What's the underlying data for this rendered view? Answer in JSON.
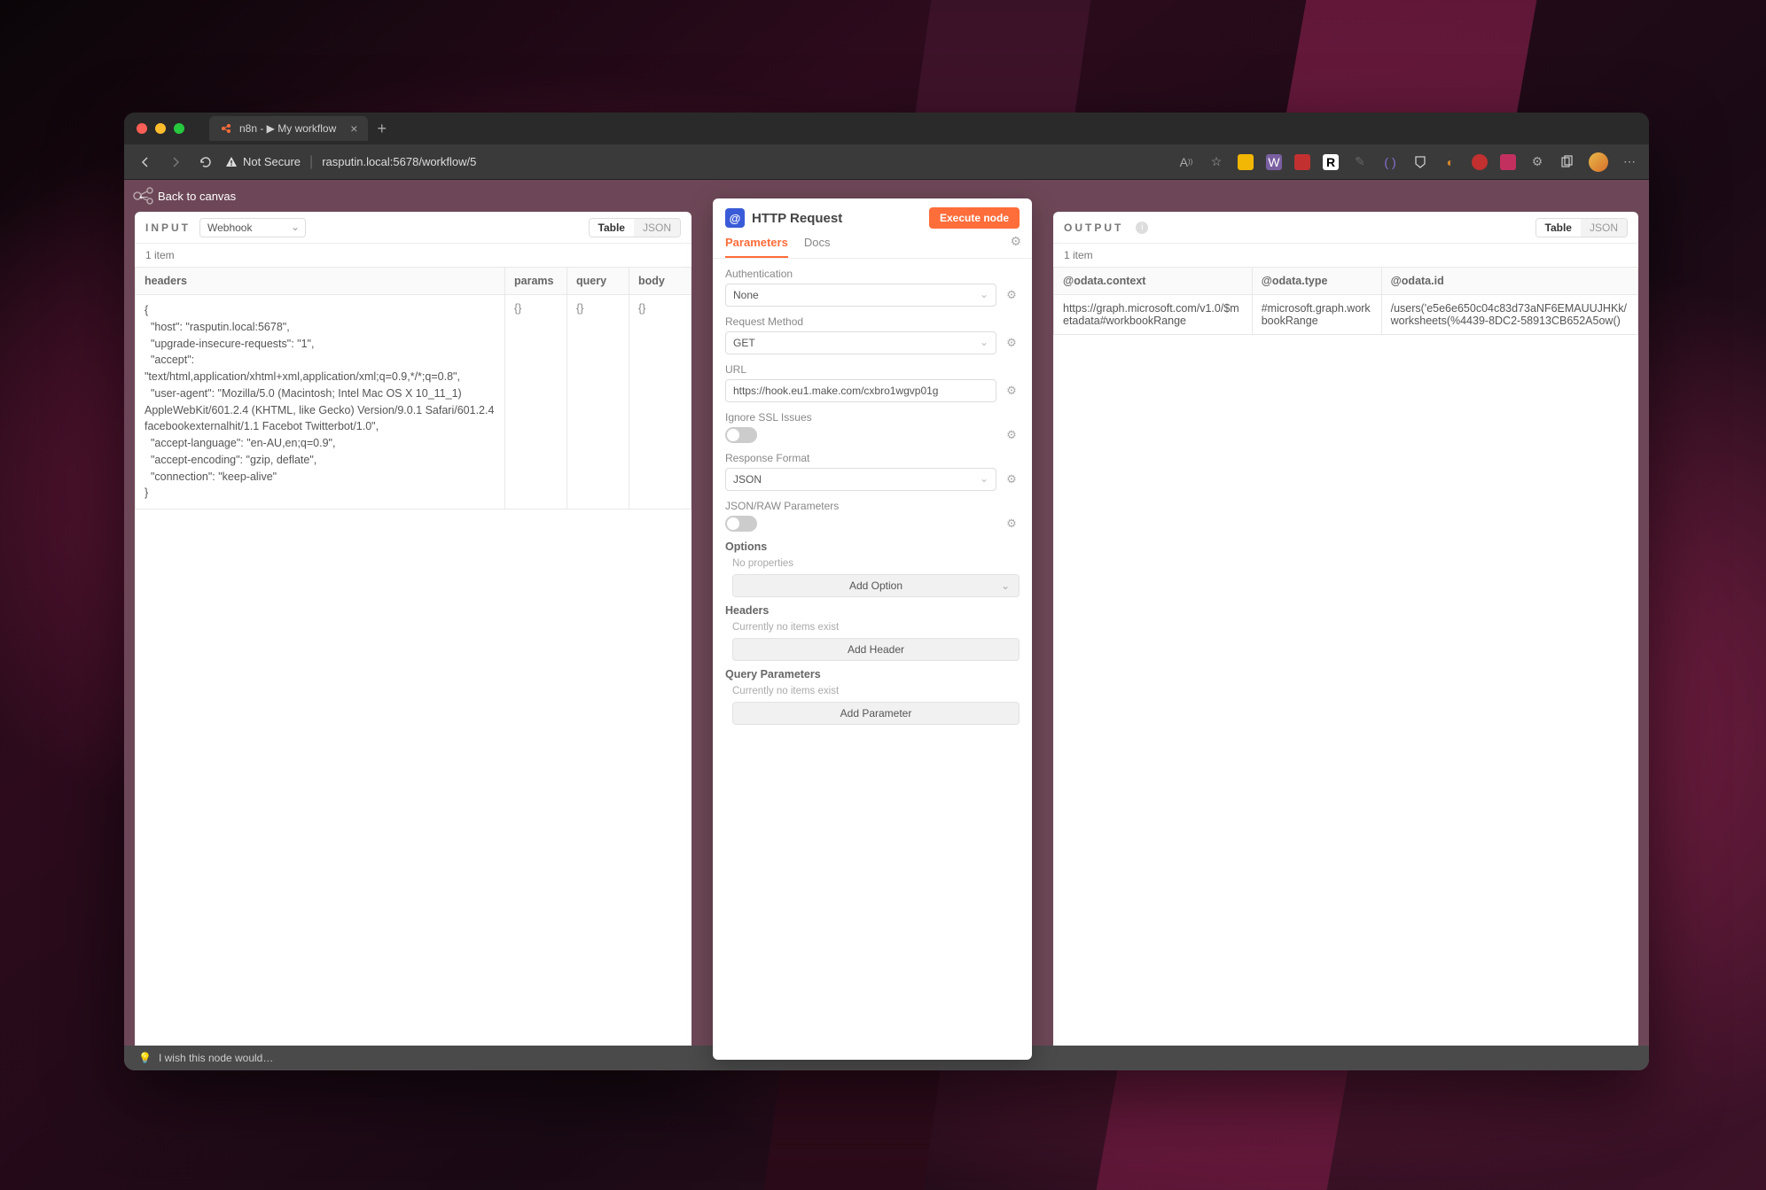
{
  "browser": {
    "tab_title": "n8n - ▶ My workflow",
    "not_secure_label": "Not Secure",
    "url": "rasputin.local:5678/workflow/5"
  },
  "app": {
    "back_label": "Back to canvas"
  },
  "input_panel": {
    "title": "INPUT",
    "source_selected": "Webhook",
    "view_table": "Table",
    "view_json": "JSON",
    "item_count": "1 item",
    "columns": [
      "headers",
      "params",
      "query",
      "body"
    ],
    "row": {
      "headers_text": "{\n  \"host\": \"rasputin.local:5678\",\n  \"upgrade-insecure-requests\": \"1\",\n  \"accept\": \"text/html,application/xhtml+xml,application/xml;q=0.9,*/*;q=0.8\",\n  \"user-agent\": \"Mozilla/5.0 (Macintosh; Intel Mac OS X 10_11_1) AppleWebKit/601.2.4 (KHTML, like Gecko) Version/9.0.1 Safari/601.2.4 facebookexternalhit/1.1 Facebot Twitterbot/1.0\",\n  \"accept-language\": \"en-AU,en;q=0.9\",\n  \"accept-encoding\": \"gzip, deflate\",\n  \"connection\": \"keep-alive\"\n}",
      "params_text": "{}",
      "query_text": "{}",
      "body_text": "{}"
    }
  },
  "node": {
    "title": "HTTP Request",
    "execute_label": "Execute node",
    "tabs": {
      "parameters": "Parameters",
      "docs": "Docs"
    },
    "fields": {
      "authentication_label": "Authentication",
      "authentication_value": "None",
      "request_method_label": "Request Method",
      "request_method_value": "GET",
      "url_label": "URL",
      "url_value": "https://hook.eu1.make.com/cxbro1wgvp01g",
      "ignore_ssl_label": "Ignore SSL Issues",
      "response_format_label": "Response Format",
      "response_format_value": "JSON",
      "json_raw_label": "JSON/RAW Parameters",
      "options_label": "Options",
      "options_empty": "No properties",
      "add_option_label": "Add Option",
      "headers_label": "Headers",
      "headers_empty": "Currently no items exist",
      "add_header_label": "Add Header",
      "query_params_label": "Query Parameters",
      "query_params_empty": "Currently no items exist",
      "add_parameter_label": "Add Parameter"
    }
  },
  "output_panel": {
    "title": "OUTPUT",
    "view_table": "Table",
    "view_json": "JSON",
    "item_count": "1 item",
    "columns": [
      "@odata.context",
      "@odata.type",
      "@odata.id"
    ],
    "row": {
      "context": "https://graph.microsoft.com/v1.0/$metadata#workbookRange",
      "type": "#microsoft.graph.workbookRange",
      "id": "/users('e5e6e650c04c83d73aNF6EMAUUJHKk/worksheets(%4439-8DC2-58913CB652A5ow()"
    }
  },
  "bottom_bar": {
    "wish_text": "I wish this node would…"
  }
}
